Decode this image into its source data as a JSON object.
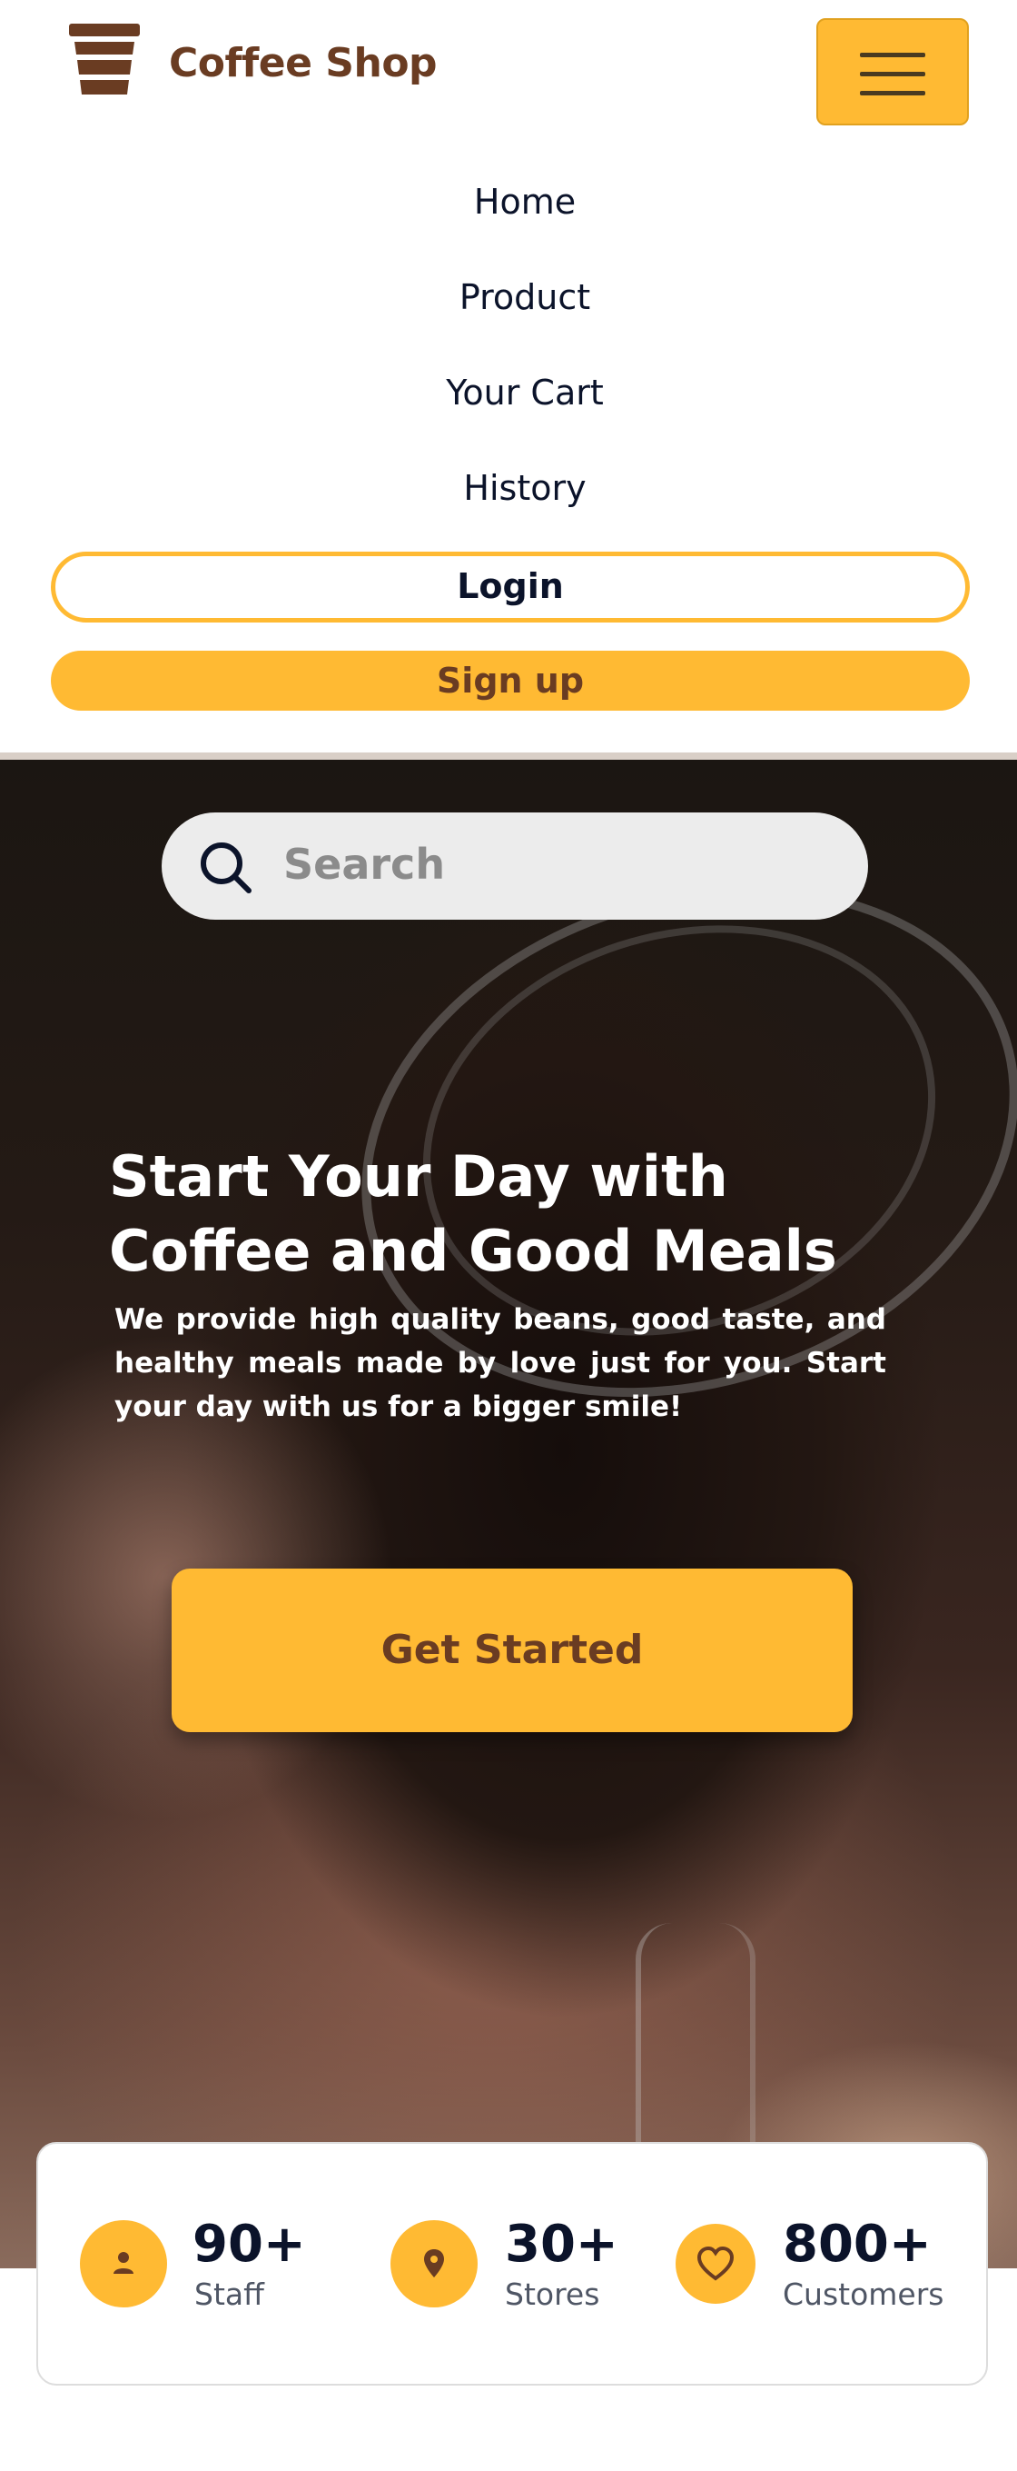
{
  "brand": {
    "name": "Coffee Shop",
    "icon": "coffee-cup-icon"
  },
  "header": {
    "menu_icon": "hamburger-menu-icon"
  },
  "nav": {
    "items": [
      {
        "label": "Home"
      },
      {
        "label": "Product"
      },
      {
        "label": "Your Cart"
      },
      {
        "label": "History"
      }
    ],
    "login_label": "Login",
    "signup_label": "Sign up"
  },
  "search": {
    "placeholder": "Search",
    "icon": "search-icon"
  },
  "hero": {
    "title_line1": "Start Your Day with",
    "title_line2": "Coffee and Good Meals",
    "description": "We provide high quality beans, good taste, and healthy meals made by love just for you. Start your day with us for a bigger smile!",
    "cta_label": "Get Started"
  },
  "stats": [
    {
      "value": "90+",
      "label": "Staff",
      "icon": "person-icon"
    },
    {
      "value": "30+",
      "label": "Stores",
      "icon": "location-pin-icon"
    },
    {
      "value": "800+",
      "label": "Customers",
      "icon": "heart-icon"
    }
  ],
  "colors": {
    "accent": "#ffba33",
    "brand_brown": "#6a3c22",
    "text_dark": "#0b132a",
    "text_muted": "#4f5665"
  }
}
